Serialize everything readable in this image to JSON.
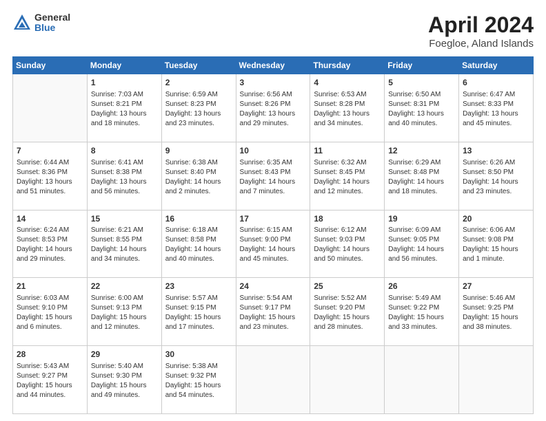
{
  "logo": {
    "general": "General",
    "blue": "Blue"
  },
  "title": "April 2024",
  "subtitle": "Foegloe, Aland Islands",
  "days_header": [
    "Sunday",
    "Monday",
    "Tuesday",
    "Wednesday",
    "Thursday",
    "Friday",
    "Saturday"
  ],
  "weeks": [
    [
      {
        "num": "",
        "info": ""
      },
      {
        "num": "1",
        "info": "Sunrise: 7:03 AM\nSunset: 8:21 PM\nDaylight: 13 hours\nand 18 minutes."
      },
      {
        "num": "2",
        "info": "Sunrise: 6:59 AM\nSunset: 8:23 PM\nDaylight: 13 hours\nand 23 minutes."
      },
      {
        "num": "3",
        "info": "Sunrise: 6:56 AM\nSunset: 8:26 PM\nDaylight: 13 hours\nand 29 minutes."
      },
      {
        "num": "4",
        "info": "Sunrise: 6:53 AM\nSunset: 8:28 PM\nDaylight: 13 hours\nand 34 minutes."
      },
      {
        "num": "5",
        "info": "Sunrise: 6:50 AM\nSunset: 8:31 PM\nDaylight: 13 hours\nand 40 minutes."
      },
      {
        "num": "6",
        "info": "Sunrise: 6:47 AM\nSunset: 8:33 PM\nDaylight: 13 hours\nand 45 minutes."
      }
    ],
    [
      {
        "num": "7",
        "info": "Sunrise: 6:44 AM\nSunset: 8:36 PM\nDaylight: 13 hours\nand 51 minutes."
      },
      {
        "num": "8",
        "info": "Sunrise: 6:41 AM\nSunset: 8:38 PM\nDaylight: 13 hours\nand 56 minutes."
      },
      {
        "num": "9",
        "info": "Sunrise: 6:38 AM\nSunset: 8:40 PM\nDaylight: 14 hours\nand 2 minutes."
      },
      {
        "num": "10",
        "info": "Sunrise: 6:35 AM\nSunset: 8:43 PM\nDaylight: 14 hours\nand 7 minutes."
      },
      {
        "num": "11",
        "info": "Sunrise: 6:32 AM\nSunset: 8:45 PM\nDaylight: 14 hours\nand 12 minutes."
      },
      {
        "num": "12",
        "info": "Sunrise: 6:29 AM\nSunset: 8:48 PM\nDaylight: 14 hours\nand 18 minutes."
      },
      {
        "num": "13",
        "info": "Sunrise: 6:26 AM\nSunset: 8:50 PM\nDaylight: 14 hours\nand 23 minutes."
      }
    ],
    [
      {
        "num": "14",
        "info": "Sunrise: 6:24 AM\nSunset: 8:53 PM\nDaylight: 14 hours\nand 29 minutes."
      },
      {
        "num": "15",
        "info": "Sunrise: 6:21 AM\nSunset: 8:55 PM\nDaylight: 14 hours\nand 34 minutes."
      },
      {
        "num": "16",
        "info": "Sunrise: 6:18 AM\nSunset: 8:58 PM\nDaylight: 14 hours\nand 40 minutes."
      },
      {
        "num": "17",
        "info": "Sunrise: 6:15 AM\nSunset: 9:00 PM\nDaylight: 14 hours\nand 45 minutes."
      },
      {
        "num": "18",
        "info": "Sunrise: 6:12 AM\nSunset: 9:03 PM\nDaylight: 14 hours\nand 50 minutes."
      },
      {
        "num": "19",
        "info": "Sunrise: 6:09 AM\nSunset: 9:05 PM\nDaylight: 14 hours\nand 56 minutes."
      },
      {
        "num": "20",
        "info": "Sunrise: 6:06 AM\nSunset: 9:08 PM\nDaylight: 15 hours\nand 1 minute."
      }
    ],
    [
      {
        "num": "21",
        "info": "Sunrise: 6:03 AM\nSunset: 9:10 PM\nDaylight: 15 hours\nand 6 minutes."
      },
      {
        "num": "22",
        "info": "Sunrise: 6:00 AM\nSunset: 9:13 PM\nDaylight: 15 hours\nand 12 minutes."
      },
      {
        "num": "23",
        "info": "Sunrise: 5:57 AM\nSunset: 9:15 PM\nDaylight: 15 hours\nand 17 minutes."
      },
      {
        "num": "24",
        "info": "Sunrise: 5:54 AM\nSunset: 9:17 PM\nDaylight: 15 hours\nand 23 minutes."
      },
      {
        "num": "25",
        "info": "Sunrise: 5:52 AM\nSunset: 9:20 PM\nDaylight: 15 hours\nand 28 minutes."
      },
      {
        "num": "26",
        "info": "Sunrise: 5:49 AM\nSunset: 9:22 PM\nDaylight: 15 hours\nand 33 minutes."
      },
      {
        "num": "27",
        "info": "Sunrise: 5:46 AM\nSunset: 9:25 PM\nDaylight: 15 hours\nand 38 minutes."
      }
    ],
    [
      {
        "num": "28",
        "info": "Sunrise: 5:43 AM\nSunset: 9:27 PM\nDaylight: 15 hours\nand 44 minutes."
      },
      {
        "num": "29",
        "info": "Sunrise: 5:40 AM\nSunset: 9:30 PM\nDaylight: 15 hours\nand 49 minutes."
      },
      {
        "num": "30",
        "info": "Sunrise: 5:38 AM\nSunset: 9:32 PM\nDaylight: 15 hours\nand 54 minutes."
      },
      {
        "num": "",
        "info": ""
      },
      {
        "num": "",
        "info": ""
      },
      {
        "num": "",
        "info": ""
      },
      {
        "num": "",
        "info": ""
      }
    ]
  ]
}
